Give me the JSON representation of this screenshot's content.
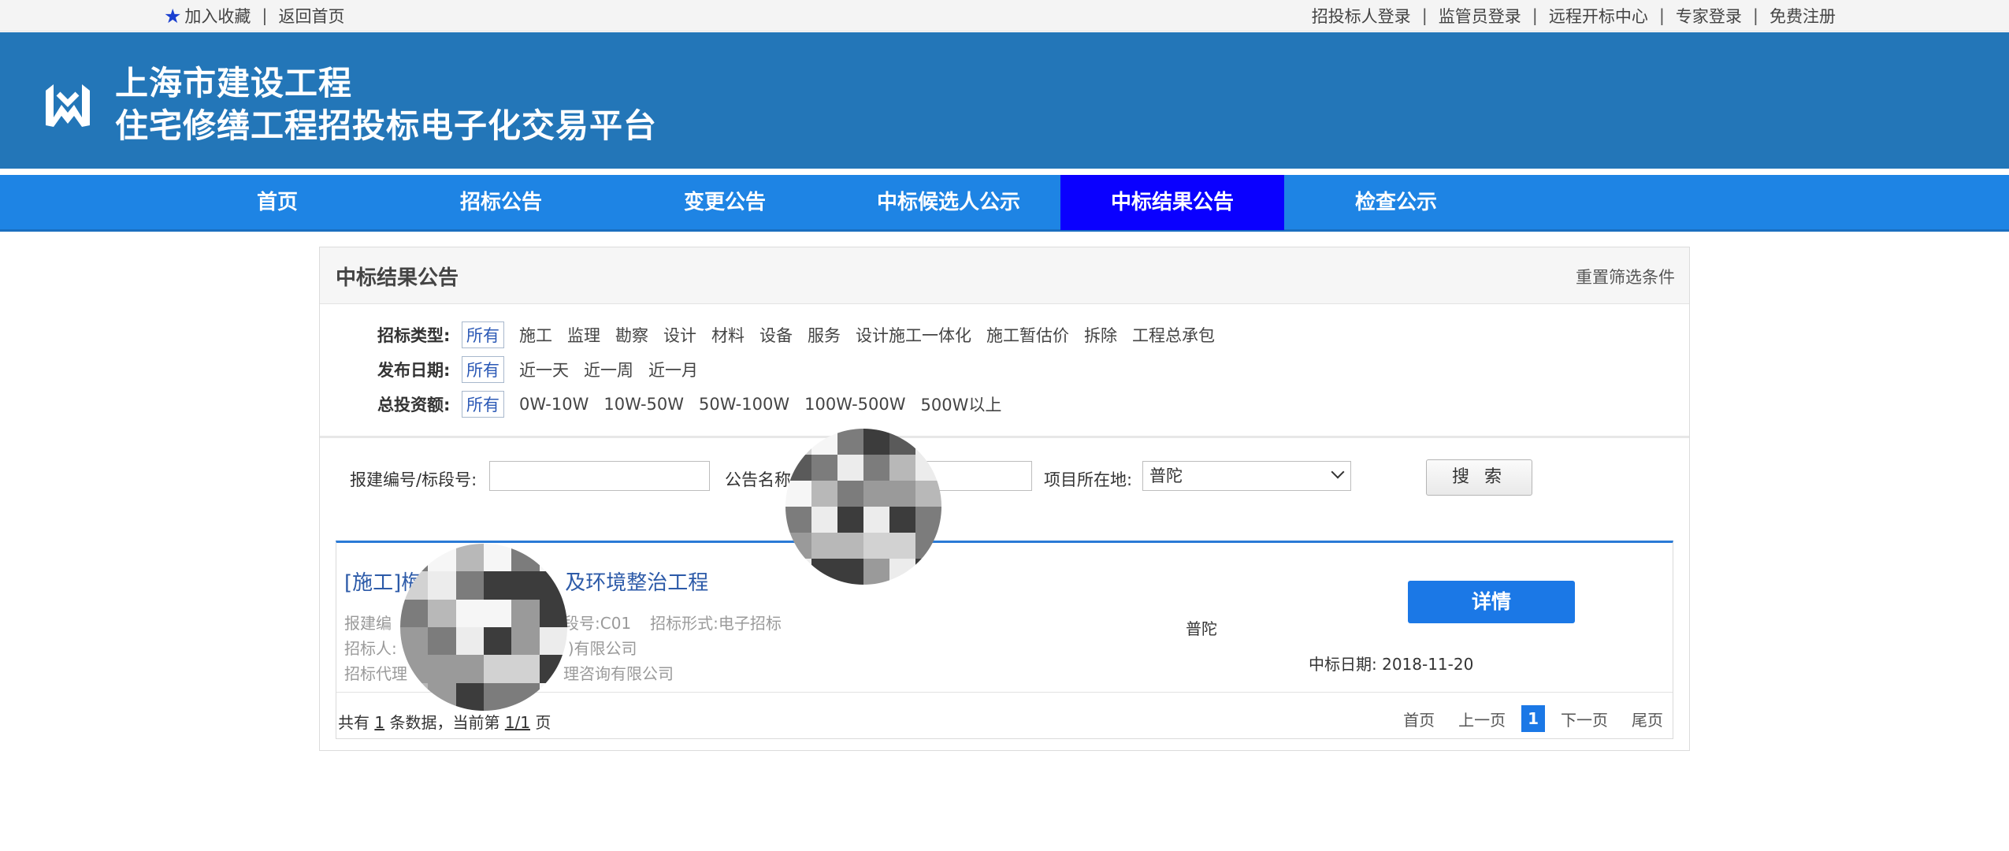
{
  "topbar": {
    "favorite": "加入收藏",
    "home": "返回首页",
    "separator": "|",
    "right_links": [
      "招投标人登录",
      "监管员登录",
      "远程开标中心",
      "专家登录",
      "免费注册"
    ]
  },
  "header": {
    "title_line1": "上海市建设工程",
    "title_line2": "住宅修缮工程招投标电子化交易平台"
  },
  "nav": {
    "items": [
      "首页",
      "招标公告",
      "变更公告",
      "中标候选人公示",
      "中标结果公告",
      "检查公示"
    ],
    "active": "中标结果公告"
  },
  "panel": {
    "title": "中标结果公告",
    "reset": "重置筛选条件"
  },
  "filters": {
    "type": {
      "label": "招标类型:",
      "options": [
        "所有",
        "施工",
        "监理",
        "勘察",
        "设计",
        "材料",
        "设备",
        "服务",
        "设计施工一体化",
        "施工暂估价",
        "拆除",
        "工程总承包"
      ]
    },
    "date": {
      "label": "发布日期:",
      "options": [
        "所有",
        "近一天",
        "近一周",
        "近一月"
      ]
    },
    "amount": {
      "label": "总投资额:",
      "options": [
        "所有",
        "0W-10W",
        "10W-50W",
        "50W-100W",
        "100W-500W",
        "500W以上"
      ]
    }
  },
  "search": {
    "code_label": "报建编号/标段号:",
    "code_value": "",
    "name_label": "公告名称:",
    "name_value": "",
    "region_label": "项目所在地:",
    "region_value": "普陀",
    "button": "搜 索"
  },
  "results": [
    {
      "title_start": "[施工]梅",
      "title_end": "及环境整治工程",
      "line1_part": "段号:C01",
      "bid_form": "招标形式:电子招标",
      "line1_prefix": "报建编",
      "line2_prefix": "招标人:",
      "line2_suffix": ")有限公司",
      "line3_prefix": "招标代理",
      "line3_suffix": "理咨询有限公司",
      "region": "普陀",
      "detail_button": "详情",
      "win_date": "中标日期: 2018-11-20"
    }
  ],
  "pager": {
    "info_prefix": "共有",
    "total": "1",
    "info_mid": "条数据，当前第",
    "page": "1/1",
    "info_suffix": "页",
    "first": "首页",
    "prev": "上一页",
    "current": "1",
    "next": "下一页",
    "last": "尾页"
  },
  "colors": {
    "header_bg": "#2376b8",
    "nav_bg": "#1e84e4",
    "nav_active": "#0a00ff",
    "link_blue": "#2c5aa8",
    "button_blue": "#1b78e6"
  }
}
